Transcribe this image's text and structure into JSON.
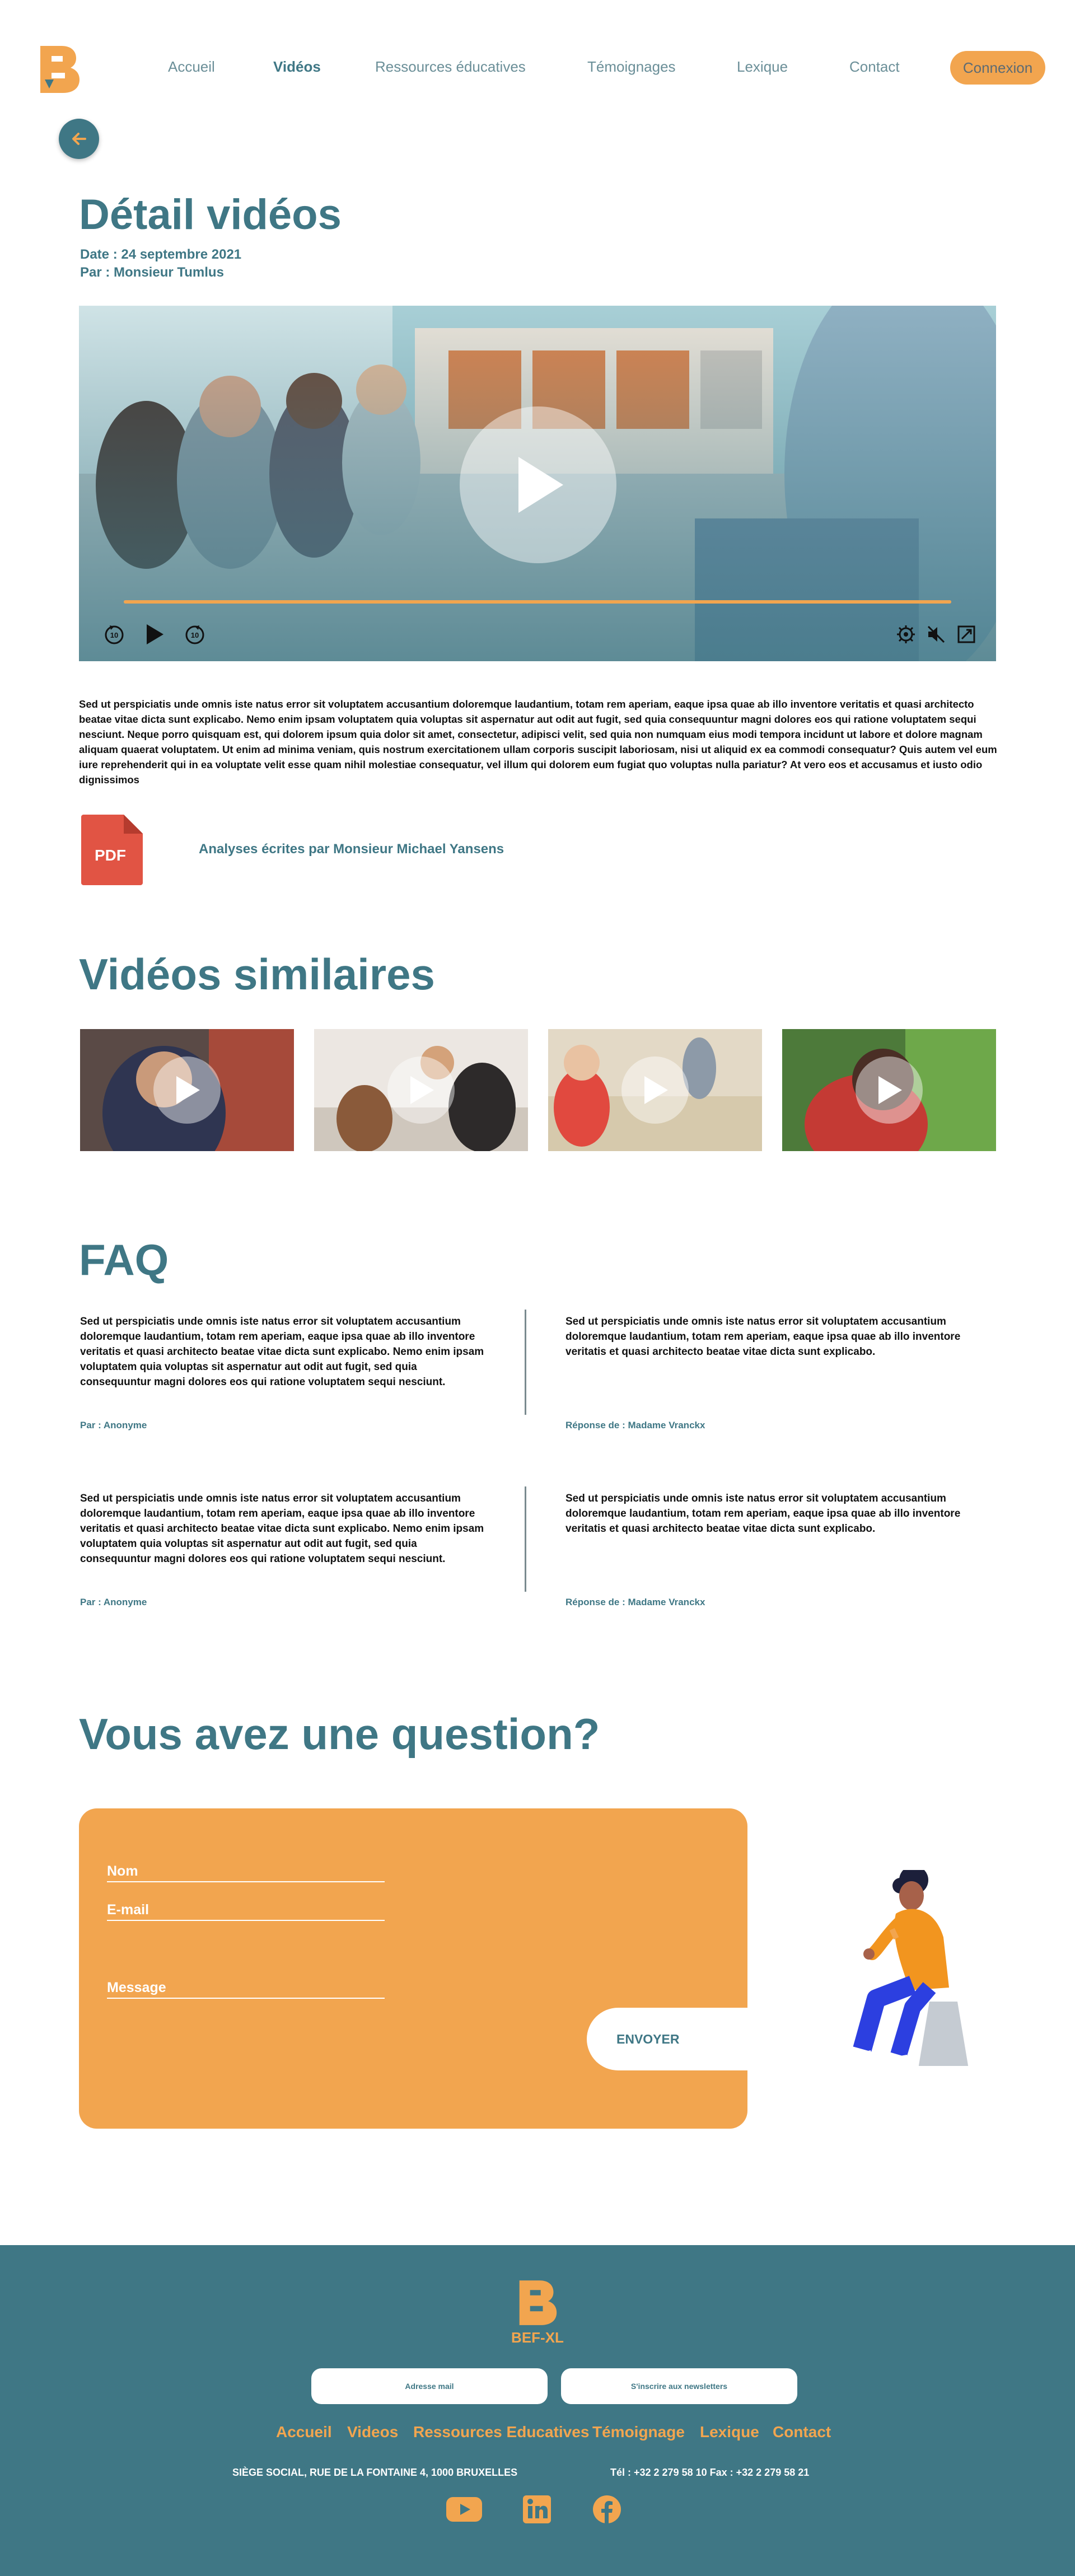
{
  "brand": {
    "name": "BEF-XL",
    "colors": {
      "primary": "#3f7785",
      "accent": "#f2a54f"
    }
  },
  "nav": {
    "items": [
      "Accueil",
      "Vidéos",
      "Ressources éducatives",
      "Témoignages",
      "Lexique",
      "Contact"
    ],
    "active": "Vidéos",
    "login": "Connexion"
  },
  "back_icon": "arrow-left-icon",
  "page": {
    "title": "Détail vidéos",
    "date": "Date : 24 septembre 2021",
    "author": "Par : Monsieur Tumlus"
  },
  "player": {
    "icons": [
      "play-icon",
      "rewind-10-icon",
      "forward-10-icon",
      "settings-icon",
      "mute-icon",
      "fullscreen-icon"
    ]
  },
  "description": "Sed ut perspiciatis unde omnis iste natus error sit voluptatem accusantium doloremque laudantium, totam rem aperiam, eaque ipsa quae ab illo inventore veritatis et quasi architecto beatae vitae dicta sunt explicabo. Nemo enim ipsam voluptatem quia voluptas sit aspernatur aut odit aut fugit, sed quia consequuntur magni dolores eos qui ratione voluptatem sequi nesciunt. Neque porro quisquam est, qui dolorem ipsum quia dolor sit amet, consectetur, adipisci velit, sed quia non numquam eius modi tempora incidunt ut labore et dolore magnam aliquam quaerat voluptatem. Ut enim ad minima veniam, quis nostrum exercitationem ullam corporis suscipit laboriosam, nisi ut aliquid ex ea commodi consequatur? Quis autem vel eum iure reprehenderit qui in ea voluptate velit esse quam nihil molestiae consequatur, vel illum qui dolorem eum fugiat quo voluptas nulla pariatur? At vero eos et accusamus et iusto odio dignissimos",
  "pdf": {
    "badge": "PDF",
    "link": "Analyses écrites par Monsieur Michael Yansens"
  },
  "similar": {
    "title": "Vidéos similaires",
    "count": 4
  },
  "faq": {
    "title": "FAQ",
    "items": [
      {
        "question": "Sed ut perspiciatis unde omnis iste natus error sit voluptatem accusantium doloremque laudantium, totam rem aperiam, eaque ipsa quae ab illo inventore veritatis et quasi architecto beatae vitae dicta sunt explicabo. Nemo enim ipsam voluptatem quia voluptas sit aspernatur aut odit aut fugit, sed quia consequuntur magni dolores eos qui ratione voluptatem sequi nesciunt.",
        "asked_by": "Par : Anonyme",
        "answer": "Sed ut perspiciatis unde omnis iste natus error sit voluptatem accusantium doloremque laudantium, totam rem aperiam, eaque ipsa quae ab illo inventore veritatis et quasi architecto beatae vitae dicta sunt explicabo.",
        "answered_by": "Réponse de : Madame Vranckx"
      },
      {
        "question": "Sed ut perspiciatis unde omnis iste natus error sit voluptatem accusantium doloremque laudantium, totam rem aperiam, eaque ipsa quae ab illo inventore veritatis et quasi architecto beatae vitae dicta sunt explicabo. Nemo enim ipsam voluptatem quia voluptas sit aspernatur aut odit aut fugit, sed quia consequuntur magni dolores eos qui ratione voluptatem sequi nesciunt.",
        "asked_by": "Par : Anonyme",
        "answer": "Sed ut perspiciatis unde omnis iste natus error sit voluptatem accusantium doloremque laudantium, totam rem aperiam, eaque ipsa quae ab illo inventore veritatis et quasi architecto beatae vitae dicta sunt explicabo.",
        "answered_by": "Réponse de : Madame Vranckx"
      }
    ]
  },
  "contact": {
    "title": "Vous avez une question?",
    "name_label": "Nom",
    "email_label": "E-mail",
    "message_label": "Message",
    "submit": "ENVOYER"
  },
  "footer": {
    "email_placeholder": "Adresse mail",
    "newsletter": "S'inscrire aux newsletters",
    "nav": [
      "Accueil",
      "Videos",
      "Ressources Educatives",
      "Témoignage",
      "Lexique",
      "Contact"
    ],
    "address": "SIÈGE SOCIAL, RUE DE LA FONTAINE 4, 1000 BRUXELLES",
    "phone": "Tél : +32 2 279 58 10 Fax : +32 2 279 58 21",
    "social_icons": [
      "youtube-icon",
      "linkedin-icon",
      "facebook-icon"
    ]
  }
}
